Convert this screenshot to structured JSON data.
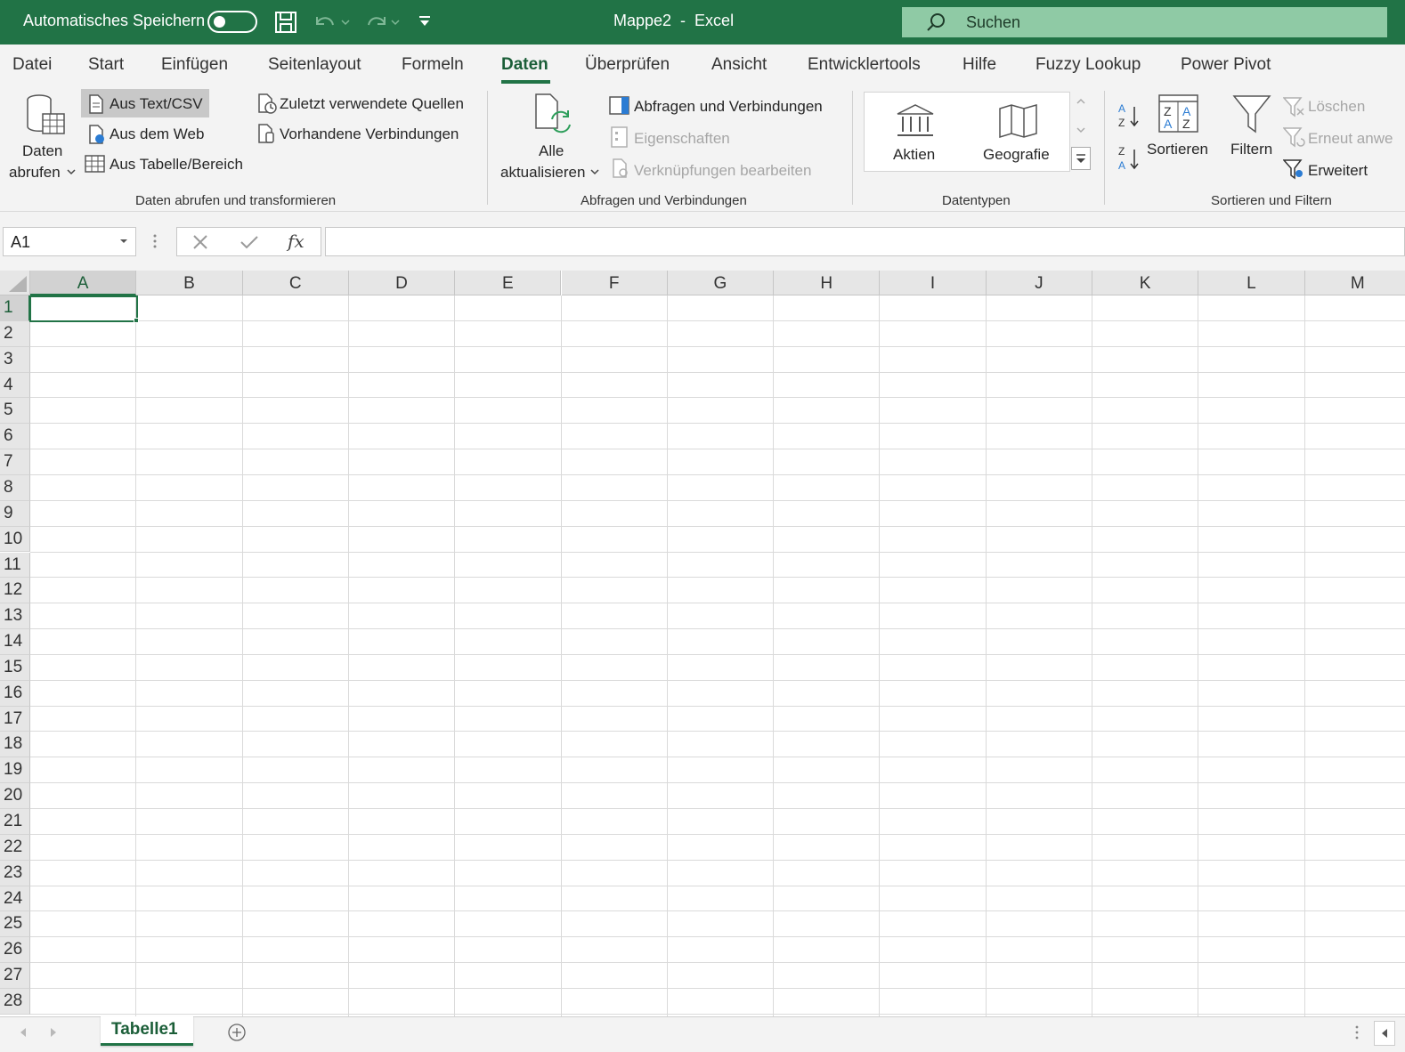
{
  "titlebar": {
    "autosave_label": "Automatisches Speichern",
    "title": "Mappe2  -  Excel",
    "search_placeholder": "Suchen"
  },
  "menu_tabs": [
    "Datei",
    "Start",
    "Einfügen",
    "Seitenlayout",
    "Formeln",
    "Daten",
    "Überprüfen",
    "Ansicht",
    "Entwicklertools",
    "Hilfe",
    "Fuzzy Lookup",
    "Power Pivot"
  ],
  "active_tab": "Daten",
  "ribbon": {
    "get_transform": {
      "get_data_line1": "Daten",
      "get_data_line2": "abrufen",
      "from_text_csv": "Aus Text/CSV",
      "from_web": "Aus dem Web",
      "from_table": "Aus Tabelle/Bereich",
      "recent_sources": "Zuletzt verwendete Quellen",
      "existing_connections": "Vorhandene Verbindungen",
      "group_label": "Daten abrufen und transformieren"
    },
    "queries": {
      "refresh_line1": "Alle",
      "refresh_line2": "aktualisieren",
      "queries_connections": "Abfragen und Verbindungen",
      "properties": "Eigenschaften",
      "edit_links": "Verknüpfungen bearbeiten",
      "group_label": "Abfragen und Verbindungen"
    },
    "datatypes": {
      "stocks": "Aktien",
      "geography": "Geografie",
      "group_label": "Datentypen"
    },
    "sort_filter": {
      "sort": "Sortieren",
      "filter": "Filtern",
      "clear": "Löschen",
      "reapply": "Erneut anwe",
      "advanced": "Erweitert",
      "group_label": "Sortieren und Filtern"
    }
  },
  "formula_bar": {
    "name_box": "A1",
    "fx": "fx",
    "formula": ""
  },
  "grid": {
    "columns": [
      "A",
      "B",
      "C",
      "D",
      "E",
      "F",
      "G",
      "H",
      "I",
      "J",
      "K",
      "L",
      "M"
    ],
    "rows": [
      "1",
      "2",
      "3",
      "4",
      "5",
      "6",
      "7",
      "8",
      "9",
      "10",
      "11",
      "12",
      "13",
      "14",
      "15",
      "16",
      "17",
      "18",
      "19",
      "20",
      "21",
      "22",
      "23",
      "24",
      "25",
      "26",
      "27",
      "28"
    ],
    "active_cell": "A1"
  },
  "sheets": [
    "Tabelle1"
  ],
  "colors": {
    "brand": "#217346",
    "search_bg": "#8fcaa5",
    "ribbon_bg": "#f3f3f3",
    "disabled_text": "#a6a6a6"
  }
}
